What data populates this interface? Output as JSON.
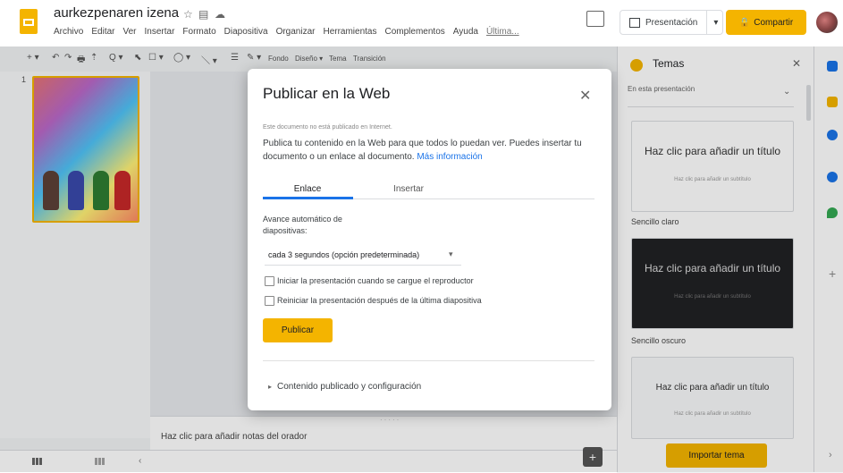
{
  "header": {
    "doc_title": "aurkezpenaren izena",
    "menu": [
      "Archivo",
      "Editar",
      "Ver",
      "Insertar",
      "Formato",
      "Diapositiva",
      "Organizar",
      "Herramientas",
      "Complementos",
      "Ayuda",
      "Última..."
    ],
    "present_label": "Presentación",
    "share_label": "Compartir",
    "share_icon": "lock-icon"
  },
  "toolbar": {
    "items": [
      "+ ▾",
      "↶",
      "↷",
      "🖶",
      "⇡",
      "Q ▾",
      "⬉",
      "☐ ▾",
      "◯ ▾",
      "＼ ▾",
      "☰",
      "✎ ▾"
    ],
    "background_label": "Fondo",
    "layout_label": "Diseño ▾",
    "theme_label": "Tema",
    "transition_label": "Transición"
  },
  "filmstrip": {
    "slide_number": "1"
  },
  "notes": {
    "placeholder": "Haz clic para añadir notas del orador"
  },
  "themes": {
    "title": "Temas",
    "dropdown_label": "En esta presentación",
    "cards": [
      {
        "title": "Haz clic para añadir un título",
        "subtitle": "Haz clic para añadir un subtítulo",
        "name": "Sencillo claro"
      },
      {
        "title": "Haz clic para añadir un título",
        "subtitle": "Haz clic para añadir un subtítulo",
        "name": "Sencillo oscuro"
      },
      {
        "title": "Haz clic para añadir un título",
        "subtitle": "Haz clic para añadir un subtítulo",
        "name": ""
      }
    ],
    "import_label": "Importar tema"
  },
  "modal": {
    "title": "Publicar en la Web",
    "status": "Este documento no está publicado en Internet.",
    "description": "Publica tu contenido en la Web para que todos lo puedan ver. Puedes insertar tu documento o un enlace al documento.",
    "more_info": "Más información",
    "tab_link": "Enlace",
    "tab_embed": "Insertar",
    "advance_label": "Avance automático de diapositivas:",
    "advance_value": "cada 3 segundos (opción predeterminada)",
    "checkbox_start": "Iniciar la presentación cuando se cargue el reproductor",
    "checkbox_restart": "Reiniciar la presentación después de la última diapositiva",
    "publish_label": "Publicar",
    "published_settings": "Contenido publicado y configuración"
  },
  "colors": {
    "accent": "#f4b400",
    "link": "#1a73e8"
  }
}
